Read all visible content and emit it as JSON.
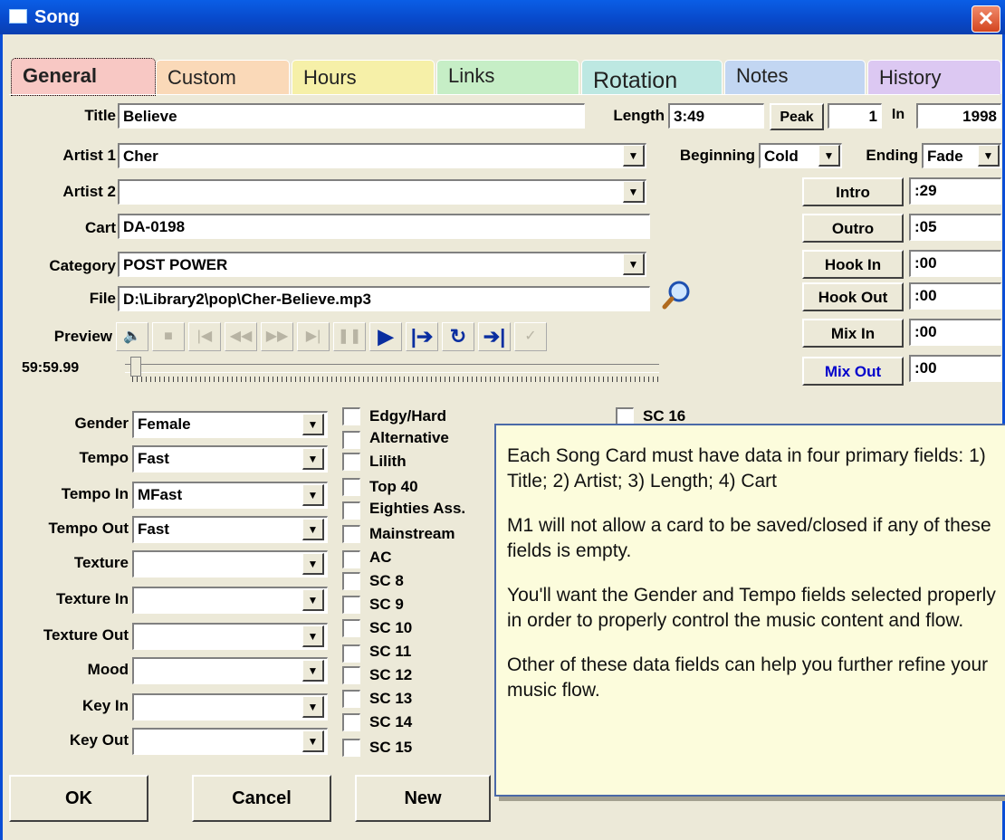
{
  "window": {
    "title": "Song",
    "close": "✕"
  },
  "tabs": [
    "General",
    "Custom",
    "Hours",
    "Links",
    "Rotation",
    "Notes",
    "History"
  ],
  "fields": {
    "title_label": "Title",
    "title_value": "Believe",
    "length_label": "Length",
    "length_value": "3:49",
    "peak_label": "Peak",
    "peak_value": "1",
    "in_label": "In",
    "year_value": "1998",
    "artist1_label": "Artist 1",
    "artist1_value": "Cher",
    "artist2_label": "Artist 2",
    "artist2_value": "",
    "beginning_label": "Beginning",
    "beginning_value": "Cold",
    "ending_label": "Ending",
    "ending_value": "Fade",
    "cart_label": "Cart",
    "cart_value": "DA-0198",
    "category_label": "Category",
    "category_value": "POST POWER",
    "file_label": "File",
    "file_value": "D:\\Library2\\pop\\Cher-Believe.mp3",
    "preview_label": "Preview",
    "time_value": "59:59.99"
  },
  "timing": [
    {
      "label": "Intro",
      "value": ":29"
    },
    {
      "label": "Outro",
      "value": ":05"
    },
    {
      "label": "Hook In",
      "value": ":00"
    },
    {
      "label": "Hook Out",
      "value": ":00"
    },
    {
      "label": "Mix In",
      "value": ":00"
    },
    {
      "label": "Mix Out",
      "value": ":00"
    }
  ],
  "attributes": [
    {
      "label": "Gender",
      "value": "Female"
    },
    {
      "label": "Tempo",
      "value": "Fast"
    },
    {
      "label": "Tempo In",
      "value": "MFast"
    },
    {
      "label": "Tempo Out",
      "value": "Fast"
    },
    {
      "label": "Texture",
      "value": ""
    },
    {
      "label": "Texture In",
      "value": ""
    },
    {
      "label": "Texture Out",
      "value": ""
    },
    {
      "label": "Mood",
      "value": ""
    },
    {
      "label": "Key In",
      "value": ""
    },
    {
      "label": "Key Out",
      "value": ""
    }
  ],
  "checkboxes": [
    "Edgy/Hard",
    "Alternative",
    "Lilith",
    "Top 40",
    "Eighties Ass.",
    "Mainstream",
    "AC",
    "SC 8",
    "SC 9",
    "SC 10",
    "SC 11",
    "SC 12",
    "SC 13",
    "SC 14",
    "SC 15",
    "SC 16"
  ],
  "buttons": {
    "ok": "OK",
    "cancel": "Cancel",
    "new": "New"
  },
  "tooltip": {
    "p1": "Each Song Card must have data in four primary fields:  1) Title; 2) Artist; 3) Length; 4) Cart",
    "p2": "M1 will not allow a card to be saved/closed if any of these fields is empty.",
    "p3": "You'll want the Gender and Tempo fields selected properly in order to properly control the music content and flow.",
    "p4": "Other of these data fields can help you further refine your music flow."
  },
  "colors": {
    "titlebar": "#0a4ed6",
    "mix_out_text": "#0000cc",
    "tooltip_bg": "#fcfcdc"
  }
}
